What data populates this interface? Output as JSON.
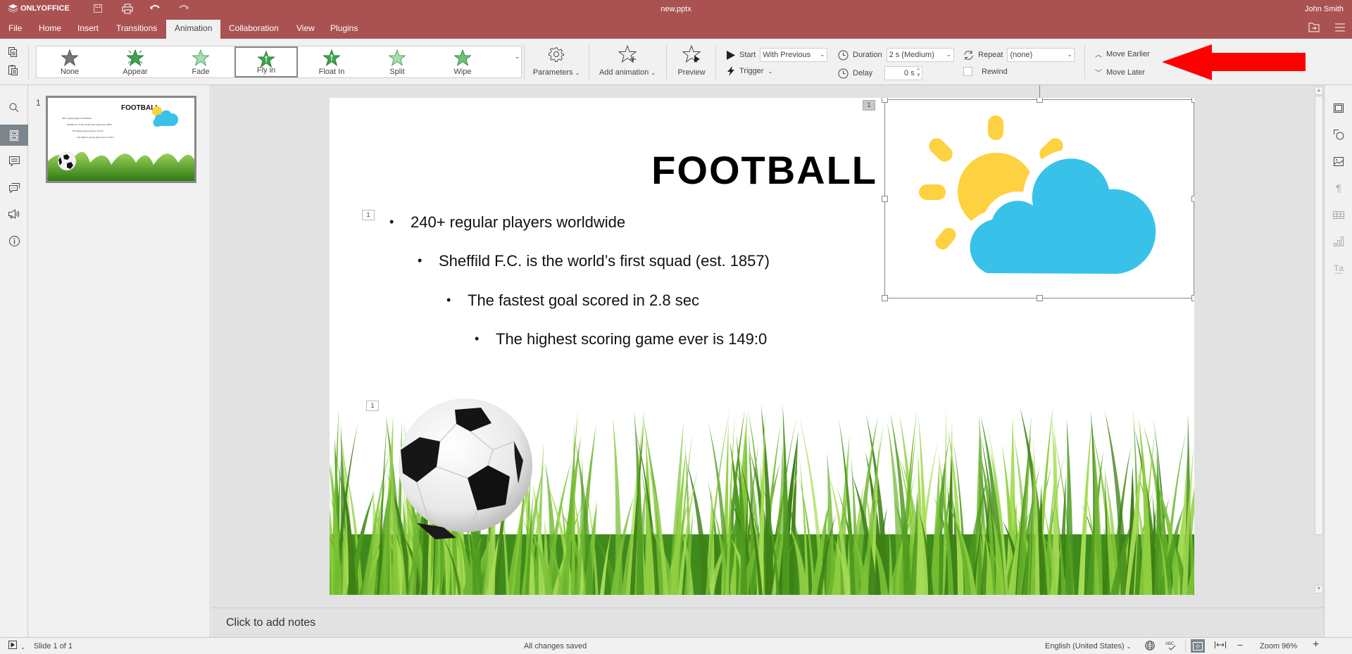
{
  "app": {
    "brand": "ONLYOFFICE",
    "doc_title": "new.pptx",
    "user_name": "John Smith",
    "accent_color": "#aa5252"
  },
  "quick_access": [
    {
      "name": "save-icon",
      "glyph": "🖫"
    },
    {
      "name": "print-icon",
      "glyph": "⎙"
    },
    {
      "name": "undo-icon",
      "glyph": "↶"
    },
    {
      "name": "redo-icon",
      "glyph": "↷"
    }
  ],
  "tabs": [
    {
      "label": "File"
    },
    {
      "label": "Home"
    },
    {
      "label": "Insert"
    },
    {
      "label": "Transitions"
    },
    {
      "label": "Animation",
      "active": true
    },
    {
      "label": "Collaboration"
    },
    {
      "label": "View"
    },
    {
      "label": "Plugins"
    }
  ],
  "ribbon": {
    "effects": [
      {
        "label": "None",
        "icon": "star-gray-icon"
      },
      {
        "label": "Appear",
        "icon": "star-appear-icon"
      },
      {
        "label": "Fade",
        "icon": "star-fade-icon"
      },
      {
        "label": "Fly in",
        "icon": "star-flyin-icon",
        "selected": true
      },
      {
        "label": "Float In",
        "icon": "star-floatin-icon"
      },
      {
        "label": "Split",
        "icon": "star-split-icon"
      },
      {
        "label": "Wipe",
        "icon": "star-wipe-icon"
      }
    ],
    "parameters_label": "Parameters",
    "add_animation_label": "Add animation",
    "preview_label": "Preview",
    "start_label": "Start",
    "start_value": "With Previous",
    "trigger_label": "Trigger",
    "duration_label": "Duration",
    "duration_value": "2 s (Medium)",
    "delay_label": "Delay",
    "delay_value": "0 s",
    "repeat_label": "Repeat",
    "repeat_value": "(none)",
    "rewind_label": "Rewind",
    "rewind_checked": false,
    "move_earlier_label": "Move Earlier",
    "move_later_label": "Move Later"
  },
  "left_panel": [
    {
      "name": "search-icon",
      "active": false
    },
    {
      "name": "slides-icon",
      "active": true
    },
    {
      "name": "comments-icon",
      "active": false
    },
    {
      "name": "chat-icon",
      "active": false
    },
    {
      "name": "feedback-icon",
      "active": false
    },
    {
      "name": "info-icon",
      "active": false
    }
  ],
  "thumbnail": {
    "number": "1",
    "title": "FOOTBALL",
    "lines": [
      "240+ regular players worldwide",
      "Sheffild F.C. is the world's first squad (est. 1857)",
      "The fastest goal scored in 2.8 sec",
      "The highest scoring game ever is 149:0"
    ]
  },
  "slide": {
    "title": "FOOTBALL",
    "bullets": [
      {
        "text": "240+ regular players worldwide",
        "level": 1
      },
      {
        "text": "Sheffild F.C. is the world’s first squad (est. 1857)",
        "level": 2
      },
      {
        "text": "The fastest goal scored in 2.8 sec",
        "level": 3
      },
      {
        "text": "The highest scoring game ever is 149:0",
        "level": 4
      }
    ],
    "animation_tags": {
      "text": "1",
      "image_weather": "1",
      "image_ball": "1"
    },
    "colors": {
      "sun": "#fdd13f",
      "cloud": "#38c2e9",
      "grass": "#5aa828"
    }
  },
  "notes_placeholder": "Click to add notes",
  "right_panel": [
    {
      "name": "slide-settings-icon",
      "dim": false
    },
    {
      "name": "shape-settings-icon",
      "dim": false
    },
    {
      "name": "image-settings-icon",
      "dim": false
    },
    {
      "name": "paragraph-settings-icon",
      "dim": true
    },
    {
      "name": "table-settings-icon",
      "dim": true
    },
    {
      "name": "chart-settings-icon",
      "dim": true
    },
    {
      "name": "textart-settings-icon",
      "dim": true
    }
  ],
  "status": {
    "slide_counter": "Slide 1 of 1",
    "save_status": "All changes saved",
    "language": "English (United States)",
    "zoom": "Zoom 96%"
  }
}
